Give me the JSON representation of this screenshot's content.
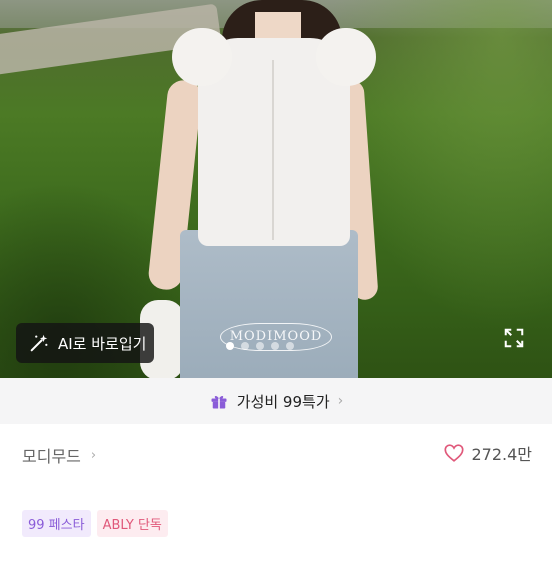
{
  "photo": {
    "watermark_text": "MODIMOOD",
    "ai_button_label": "AI로 바로입기",
    "slide_count": 5,
    "active_slide": 1
  },
  "promo": {
    "label": "가성비 99특가",
    "chevron": "›"
  },
  "seller": {
    "name": "모디무드",
    "chevron": "›",
    "likes": "272.4만"
  },
  "badges": [
    {
      "label": "99 페스타"
    },
    {
      "label": "ABLY 단독"
    }
  ],
  "product_title_peek": "",
  "colors": {
    "accent_purple": "#8a5cd8",
    "accent_pink": "#e0587a",
    "heart": "#e0587a"
  },
  "icons": {
    "ai": "magic-wand-icon",
    "expand": "expand-icon",
    "promo": "gift-icon",
    "like": "heart-icon"
  }
}
